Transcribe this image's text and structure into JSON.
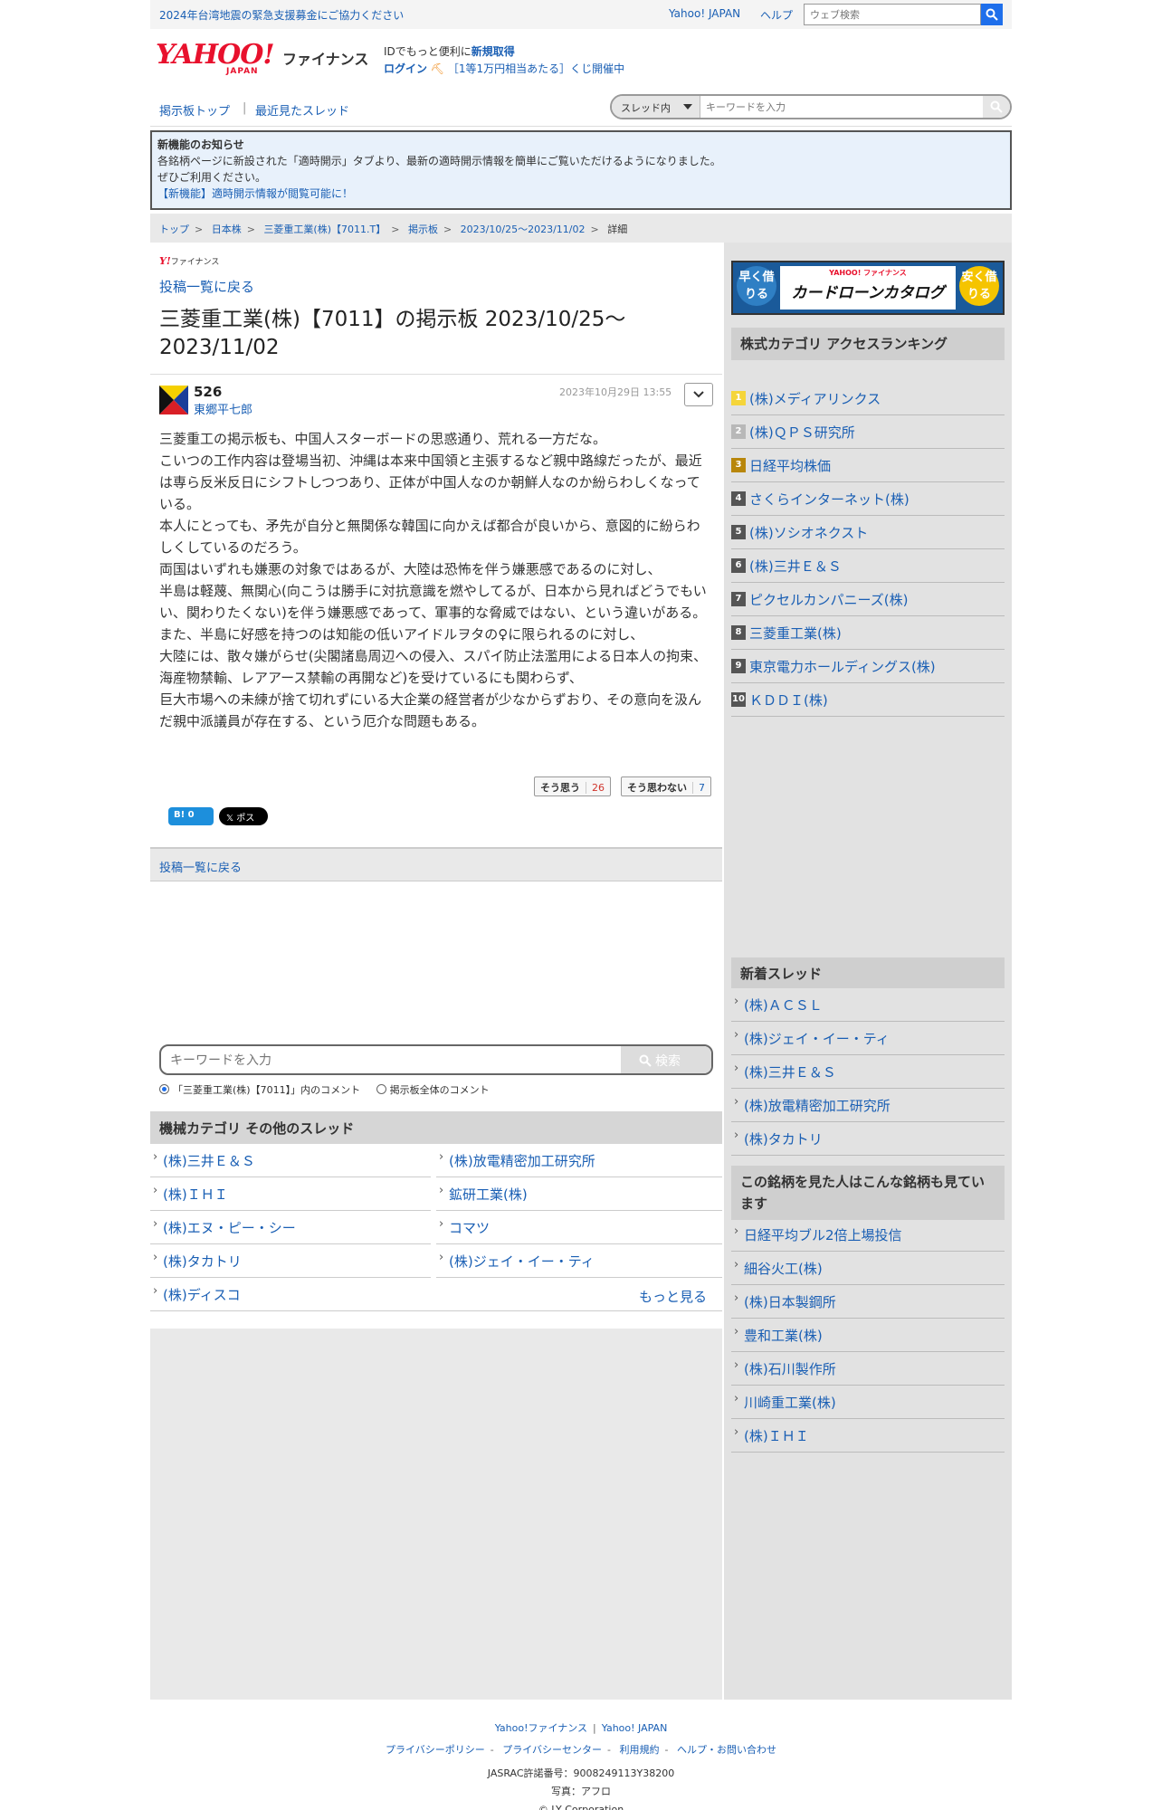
{
  "topbar": {
    "notice": "2024年台湾地震の緊急支援募金にご協力ください",
    "yahoo_japan": "Yahoo! JAPAN",
    "help": "ヘルプ",
    "web_search_placeholder": "ウェブ検索"
  },
  "header": {
    "logo_text": "YAHOO!",
    "logo_sub": "JAPAN",
    "service_name": "ファイナンス",
    "id_line_prefix": "IDでもっと便利に",
    "id_line_link": "新規取得",
    "login": "ログイン",
    "lottery": "［1等1万円相当あたる］くじ開催中"
  },
  "nav": {
    "board_top": "掲示板トップ",
    "recent_threads": "最近見たスレッド",
    "search_scope": "スレッド内",
    "search_placeholder": "キーワードを入力"
  },
  "news": {
    "title": "新機能のお知らせ",
    "line1": "各銘柄ページに新設された「適時開示」タブより、最新の適時開示情報を簡単にご覧いただけるようになりました。",
    "line2": "ぜひご利用ください。",
    "link": "【新機能】適時開示情報が閲覧可能に！"
  },
  "breadcrumb": [
    "トップ",
    "日本株",
    "三菱重工業(株)【7011.T】",
    "掲示板",
    "2023/10/25〜2023/11/02",
    "詳細"
  ],
  "main": {
    "mini_logo": "ファイナンス",
    "back_to_list": "投稿一覧に戻る",
    "title": "三菱重工業(株)【7011】の掲示板 2023/10/25〜2023/11/02",
    "post": {
      "number": "526",
      "user": "東郷平七郎",
      "date": "2023年10月29日 13:55",
      "body": [
        "三菱重工の掲示板も、中国人スターボードの思惑通り、荒れる一方だな。",
        "こいつの工作内容は登場当初、沖縄は本来中国領と主張するなど親中路線だったが、最近は専ら反米反日にシフトしつつあり、正体が中国人なのか朝鮮人なのか紛らわしくなっている。",
        "本人にとっても、矛先が自分と無関係な韓国に向かえば都合が良いから、意図的に紛らわしくしているのだろう。",
        "両国はいずれも嫌悪の対象ではあるが、大陸は恐怖を伴う嫌悪感であるのに対し、",
        "半島は軽蔑、無関心(向こうは勝手に対抗意識を燃やしてるが、日本から見ればどうでもいい、関わりたくない)を伴う嫌悪感であって、軍事的な脅威ではない、という違いがある。",
        "また、半島に好感を持つのは知能の低いアイドルヲタの♀に限られるのに対し、",
        "大陸には、散々嫌がらせ(尖閣諸島周辺への侵入、スパイ防止法濫用による日本人の拘束、海産物禁輸、レアアース禁輸の再開など)を受けているにも関わらず、",
        "巨大市場への未練が捨て切れずにいる大企業の経営者が少なからずおり、その意向を汲んだ親中派議員が存在する、という厄介な問題もある。"
      ],
      "agree_label": "そう思う",
      "agree_count": "26",
      "disagree_label": "そう思わない",
      "disagree_count": "7",
      "hatena": "B! 0",
      "xpost": "𝕏 ポスト"
    },
    "back_to_list_2": "投稿一覧に戻る",
    "kw_placeholder": "キーワードを入力",
    "kw_button": "検索",
    "radio_thread": "「三菱重工業(株)【7011】」内のコメント",
    "radio_all": "掲示板全体のコメント",
    "category_head": "機械カテゴリ その他のスレッド",
    "category_items": [
      "(株)三井Ｅ＆Ｓ",
      "(株)放電精密加工研究所",
      "(株)ＩＨＩ",
      "鉱研工業(株)",
      "(株)エヌ・ピー・シー",
      "コマツ",
      "(株)タカトリ",
      "(株)ジェイ・イー・ティ",
      "(株)ディスコ"
    ],
    "more": "もっと見る"
  },
  "side": {
    "banner_left": "早く借りる",
    "banner_right": "安く借りる",
    "banner_small": "YAHOO! ファイナンス",
    "banner_main": "カードローンカタログ",
    "ranking_head": "株式カテゴリ アクセスランキング",
    "ranking": [
      {
        "rank": "1",
        "name": "(株)メディアリンクス",
        "color": "#f5d53a"
      },
      {
        "rank": "2",
        "name": "(株)ＱＰＳ研究所",
        "color": "#b8b8b8"
      },
      {
        "rank": "3",
        "name": "日経平均株価",
        "color": "#b8860b"
      },
      {
        "rank": "4",
        "name": "さくらインターネット(株)",
        "color": "#555555"
      },
      {
        "rank": "5",
        "name": "(株)ソシオネクスト",
        "color": "#555555"
      },
      {
        "rank": "6",
        "name": "(株)三井Ｅ＆Ｓ",
        "color": "#555555"
      },
      {
        "rank": "7",
        "name": "ピクセルカンパニーズ(株)",
        "color": "#555555"
      },
      {
        "rank": "8",
        "name": "三菱重工業(株)",
        "color": "#555555"
      },
      {
        "rank": "9",
        "name": "東京電力ホールディングス(株)",
        "color": "#555555"
      },
      {
        "rank": "10",
        "name": "ＫＤＤＩ(株)",
        "color": "#555555"
      }
    ],
    "new_threads_head": "新着スレッド",
    "new_threads": [
      "(株)ＡＣＳＬ",
      "(株)ジェイ・イー・ティ",
      "(株)三井Ｅ＆Ｓ",
      "(株)放電精密加工研究所",
      "(株)タカトリ"
    ],
    "also_viewed_head": "この銘柄を見た人はこんな銘柄も見ています",
    "also_viewed": [
      "日経平均ブル2倍上場投信",
      "細谷火工(株)",
      "(株)日本製鋼所",
      "豊和工業(株)",
      "(株)石川製作所",
      "川崎重工業(株)",
      "(株)ＩＨＩ"
    ]
  },
  "footer": {
    "yf": "Yahoo!ファイナンス",
    "yj": "Yahoo! JAPAN",
    "links": [
      "プライバシーポリシー",
      "プライバシーセンター",
      "利用規約",
      "ヘルプ・お問い合わせ"
    ],
    "jasrac": "JASRAC許諾番号：9008249113Y38200",
    "photo": "写真：アフロ",
    "copyright": "© LY Corporation"
  }
}
